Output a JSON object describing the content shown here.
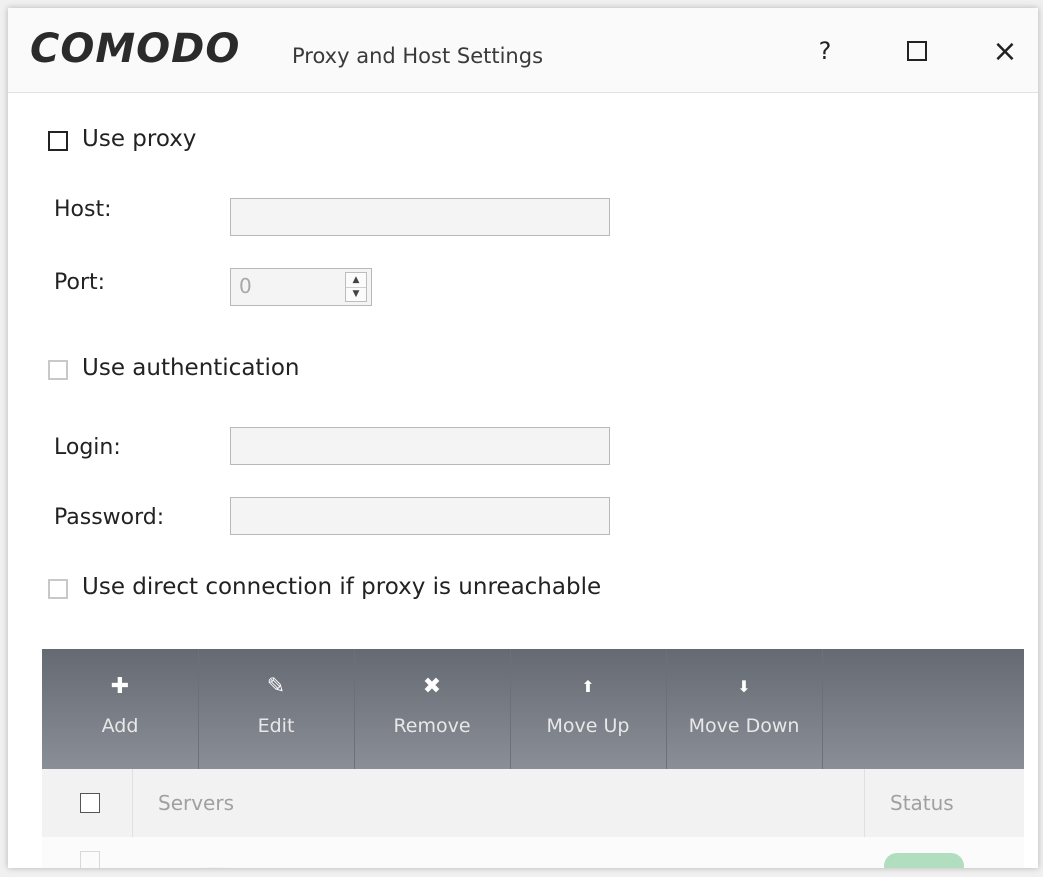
{
  "window": {
    "brand": "COMODO",
    "title": "Proxy and Host Settings",
    "help_glyph": "?",
    "close_glyph": "×"
  },
  "proxy": {
    "use_proxy_label": "Use proxy",
    "use_proxy_checked": false,
    "host_label": "Host:",
    "host_value": "",
    "port_label": "Port:",
    "port_value": "0"
  },
  "auth": {
    "use_auth_label": "Use authentication",
    "use_auth_checked": false,
    "login_label": "Login:",
    "login_value": "",
    "password_label": "Password:",
    "password_value": ""
  },
  "direct": {
    "label": "Use direct connection if proxy is unreachable",
    "checked": false
  },
  "toolbar": {
    "items": [
      {
        "label": "Add",
        "icon": "plus-icon",
        "glyph": "✚"
      },
      {
        "label": "Edit",
        "icon": "pencil-icon",
        "glyph": "✎"
      },
      {
        "label": "Remove",
        "icon": "x-icon",
        "glyph": "✖"
      },
      {
        "label": "Move Up",
        "icon": "arrow-up-icon",
        "glyph": "⬆"
      },
      {
        "label": "Move Down",
        "icon": "arrow-down-icon",
        "glyph": "⬇"
      }
    ]
  },
  "table": {
    "col_servers": "Servers",
    "col_status": "Status"
  },
  "colors": {
    "toolbar_top": "#656a72",
    "toolbar_bottom": "#8a8f97",
    "status_green": "#9fd7b0"
  }
}
